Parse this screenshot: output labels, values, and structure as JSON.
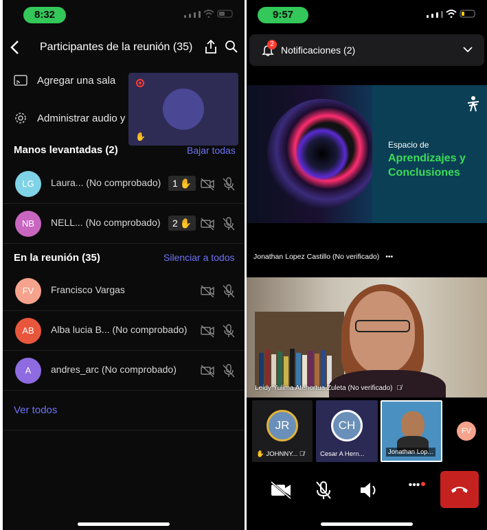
{
  "left": {
    "time": "8:32",
    "header": {
      "title": "Participantes de la reunión (35)"
    },
    "actions": {
      "add_room": "Agregar una sala",
      "manage_audio": "Administrar audio y"
    },
    "raised_hands": {
      "title": "Manos levantadas (2)",
      "lower_all": "Bajar todas",
      "participants": [
        {
          "initials": "LG",
          "name": "Laura... (No comprobado)",
          "order": "1",
          "avatar_color": "#7fd3e6"
        },
        {
          "initials": "NB",
          "name": "NELL... (No comprobado)",
          "order": "2",
          "avatar_color": "#c866c0"
        }
      ]
    },
    "in_meeting": {
      "title": "En la reunión (35)",
      "mute_all": "Silenciar a todos",
      "participants": [
        {
          "initials": "FV",
          "name": "Francisco Vargas",
          "avatar_color": "#f5a38c"
        },
        {
          "initials": "AB",
          "name": "Alba lucia B... (No comprobado)",
          "avatar_color": "#e8573d"
        },
        {
          "initials": "A",
          "name": "andres_arc (No comprobado)",
          "avatar_color": "#8e6be0"
        }
      ]
    },
    "see_all": "Ver todos"
  },
  "right": {
    "time": "9:57",
    "notifications": {
      "badge": "2",
      "label": "Notificaciones (2)"
    },
    "slide": {
      "small": "Espacio de",
      "big_line1": "Aprendizajes y",
      "big_line2": "Conclusiones"
    },
    "presenter": "Jonathan Lopez Castillo (No verificado)",
    "presenter_more": "•••",
    "video_label": "Leidy Yulima Atehortua Zuleta (No verificado)",
    "thumbnails": [
      {
        "initials": "JR",
        "label": "JOHNNY...",
        "avatar_color": "#6a8fb8",
        "ring": "#e0b43a"
      },
      {
        "initials": "CH",
        "label": "Cesar A Hern...",
        "avatar_color": "#6a8fb8",
        "ring": "#ffffff"
      },
      {
        "initials": "",
        "label": "Jonathan Lop...",
        "avatar_color": "#4a90c0",
        "ring": ""
      },
      {
        "initials": "FV",
        "label": "",
        "avatar_color": "#f5a38c",
        "ring": ""
      }
    ],
    "controls_more": "•••"
  }
}
